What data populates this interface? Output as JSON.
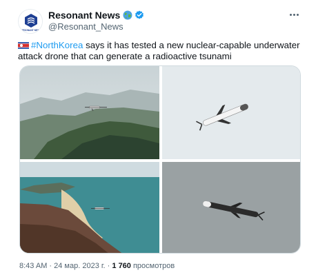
{
  "author": {
    "display_name": "Resonant News",
    "handle": "@Resonant_News",
    "avatar_text": "RESONANT NEWS"
  },
  "tweet": {
    "hashtag": "#NorthKorea",
    "text": " says it has tested a new nuclear-capable underwater attack drone that can generate a radioactive tsunami",
    "flag_icon": "north-korea-flag-icon"
  },
  "meta": {
    "time": "8:43 AM",
    "separator1": " · ",
    "date": "24 мар. 2023 г.",
    "separator2": " · ",
    "views_count": "1 760",
    "views_label": " просмотров"
  },
  "icons": {
    "globe": "globe-emoji-icon",
    "verified": "verified-badge-icon",
    "more": "more-options-icon"
  },
  "colors": {
    "link": "#1d9bf0",
    "text": "#0f1419",
    "secondary": "#536471"
  },
  "media": {
    "count": 4
  }
}
